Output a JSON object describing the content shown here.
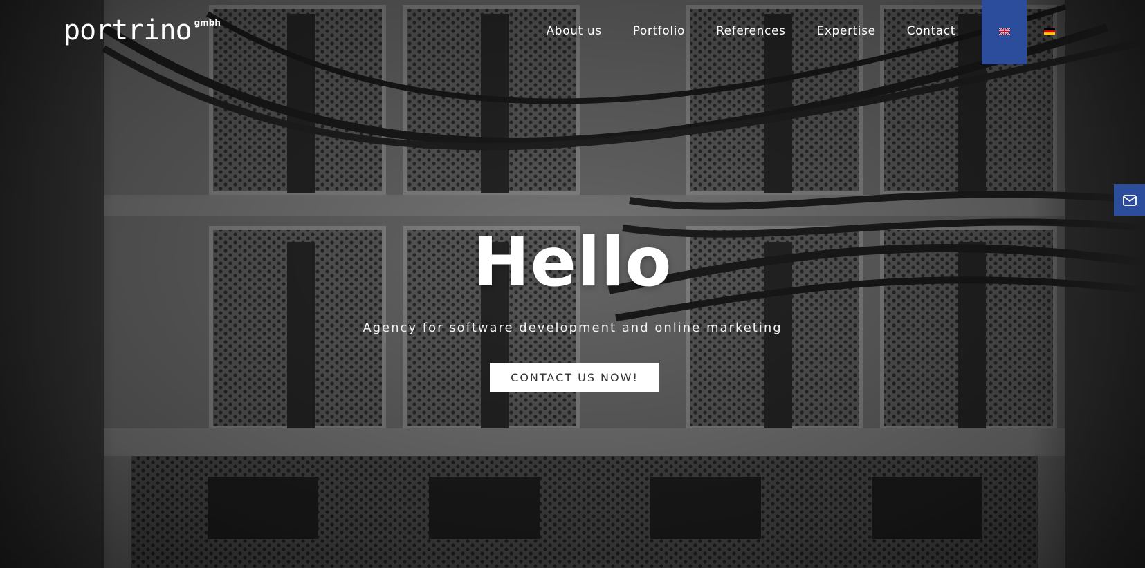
{
  "brand": {
    "name": "portrino",
    "suffix": "gmbh"
  },
  "nav": {
    "items": [
      {
        "label": "About us"
      },
      {
        "label": "Portfolio"
      },
      {
        "label": "References"
      },
      {
        "label": "Expertise"
      },
      {
        "label": "Contact"
      }
    ],
    "languages": [
      {
        "code": "en",
        "icon": "uk-flag-icon",
        "active": true
      },
      {
        "code": "de",
        "icon": "german-flag-icon",
        "active": false
      }
    ]
  },
  "hero": {
    "title": "Hello",
    "subtitle": "Agency for software development and online marketing",
    "cta_label": "CONTACT US NOW!"
  },
  "side_tab": {
    "icon": "envelope-icon"
  },
  "colors": {
    "accent": "#2b4d9b",
    "cta_background": "#ffffff",
    "cta_text": "#333333"
  }
}
